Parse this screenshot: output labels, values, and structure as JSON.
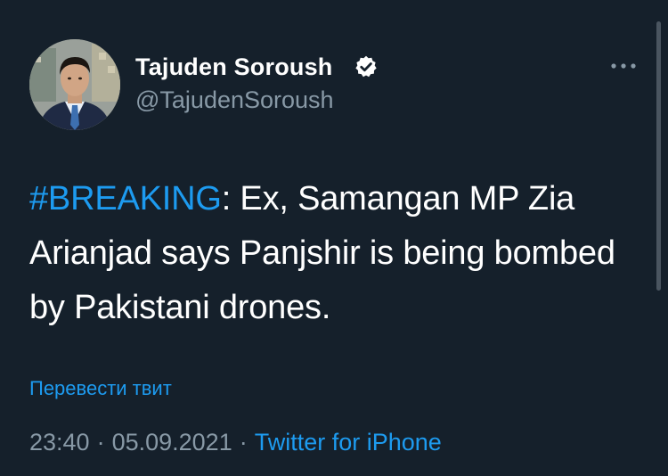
{
  "author": {
    "name": "Tajuden Soroush",
    "handle": "@TajudenSoroush",
    "verified_icon": "verified-badge-icon"
  },
  "tweet": {
    "hashtag": "#BREAKING",
    "text": ": Ex, Samangan MP Zia Arianjad says Panjshir is being bombed by Pakistani drones."
  },
  "translate_label": "Перевести твит",
  "meta": {
    "time": "23:40",
    "separator": "·",
    "date": "05.09.2021",
    "source": "Twitter for iPhone"
  },
  "colors": {
    "background": "#15202b",
    "accent": "#1d9bf0",
    "secondary_text": "#8899a6",
    "primary_text": "#ffffff"
  },
  "icons": {
    "more": "more-horizontal-icon",
    "avatar": "avatar"
  }
}
